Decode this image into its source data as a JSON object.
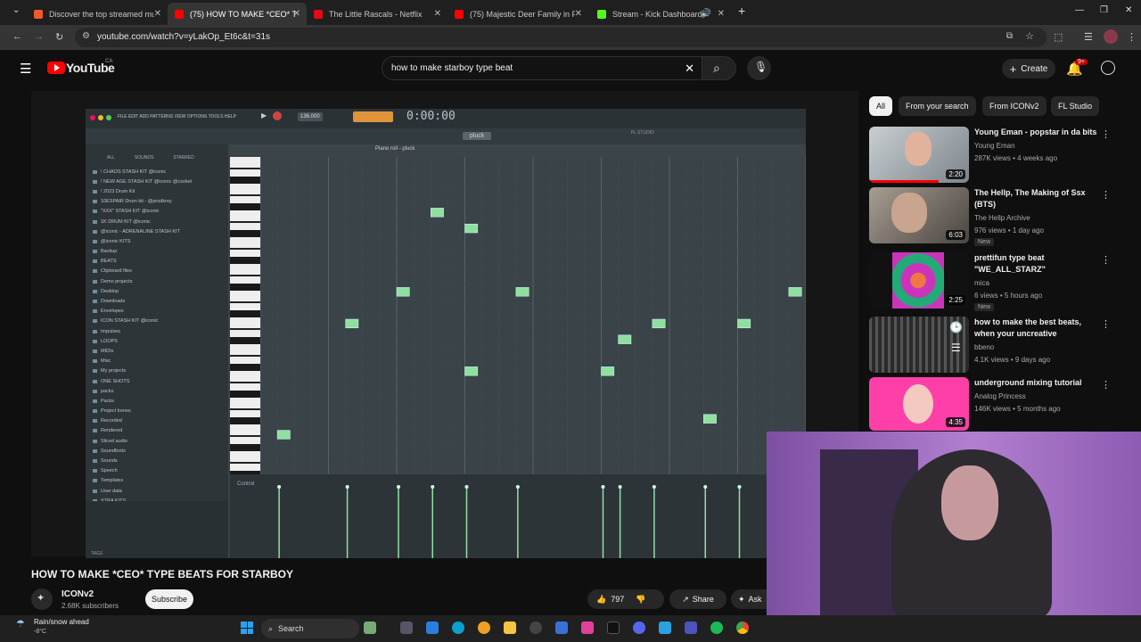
{
  "browser": {
    "tabs": [
      {
        "title": "Discover the top streamed mu",
        "color": "#f05a28"
      },
      {
        "title": "(75) HOW TO MAKE *CEO* TYP",
        "color": "#ff0000"
      },
      {
        "title": "The Little Rascals - Netflix",
        "color": "#e50914"
      },
      {
        "title": "(75) Majestic Deer Family in Fo",
        "color": "#ff0000"
      },
      {
        "title": "Stream - Kick Dashboard",
        "color": "#53fc18"
      }
    ],
    "url": "youtube.com/watch?v=yLakOp_Et6c&t=31s"
  },
  "youtube": {
    "logo": "YouTube",
    "region": "CA",
    "search_query": "how to make starboy type beat",
    "create_label": "Create",
    "notif_count": "9+"
  },
  "chips": [
    "All",
    "From your search",
    "From ICONv2",
    "FL Studio"
  ],
  "video": {
    "title": "HOW TO MAKE *CEO* TYPE BEATS FOR STARBOY",
    "channel": "ICONv2",
    "subscribers": "2.68K subscribers",
    "subscribe_label": "Subscribe",
    "likes": "797",
    "share_label": "Share",
    "ask_label": "Ask"
  },
  "fl": {
    "menu": "FILE  EDIT  ADD  PATTERNS  VIEW  OPTIONS  TOOLS  HELP",
    "tempo": "136.000",
    "time": "0:00:00",
    "browser_tabs": [
      "ALL",
      "SOUNDS",
      "STARRED"
    ],
    "folders": [
      "! CHAOS STASH KIT @iconic",
      "! NEW AGE STASH KIT @iconic @csxket",
      "! 2023 Drum Kit",
      "10ESPAIR Drum kit - @prodkrey",
      "\"XXX\" STASH KIT @iconic",
      "1K DRUM KIT @iconic",
      "@iconic - ADRENALINE STASH KIT",
      "@iconic KITS",
      "Backup",
      "BEATS",
      "Clipboard files",
      "Demo projects",
      "Desktop",
      "Downloads",
      "Envelopes",
      "ICON STASH KIT @iconic",
      "Impulses",
      "LOOPS",
      "MIDIs",
      "Misc",
      "My projects",
      "ONE SHOTS",
      "packs",
      "Packs",
      "Project bones",
      "Recorded",
      "Rendered",
      "Sliced audio",
      "Soundfonts",
      "Sounds",
      "Speech",
      "Templates",
      "User data",
      "XTRA KITS"
    ],
    "piano_roll_title": "Piano roll - pluck",
    "instrument": "pluck",
    "control_label": "Control",
    "tags_label": "TAGS",
    "studio_label": "FL STUDIO",
    "notes": [
      {
        "step": 1,
        "row": 17
      },
      {
        "step": 5,
        "row": 10
      },
      {
        "step": 8,
        "row": 8
      },
      {
        "step": 10,
        "row": 3
      },
      {
        "step": 12,
        "row": 4
      },
      {
        "step": 12,
        "row": 13
      },
      {
        "step": 15,
        "row": 8
      },
      {
        "step": 20,
        "row": 13
      },
      {
        "step": 21,
        "row": 11
      },
      {
        "step": 23,
        "row": 10
      },
      {
        "step": 26,
        "row": 16
      },
      {
        "step": 28,
        "row": 10
      },
      {
        "step": 31,
        "row": 8
      }
    ],
    "velocity_steps": [
      1,
      5,
      8,
      10,
      12,
      15,
      20,
      21,
      23,
      26,
      28
    ]
  },
  "recommendations": [
    {
      "title": "Young Eman - popstar in da bits",
      "channel": "Young Eman",
      "meta": "287K views • 4 weeks ago",
      "duration": "2:20",
      "badge": "",
      "thumb_color": "#9aa2a8"
    },
    {
      "title": "The Hellp, The Making of Ssx (BTS)",
      "channel": "The Hellp Archive",
      "meta": "976 views • 1 day ago",
      "duration": "6:03",
      "badge": "New",
      "thumb_color": "#6b6560"
    },
    {
      "title": "prettifun type beat \"WE_ALL_STARZ\"",
      "channel": "mica",
      "meta": "6 views • 5 hours ago",
      "duration": "2:25",
      "badge": "New",
      "thumb_color": "#c63bb0"
    },
    {
      "title": "how to make the best beats, when your uncreative",
      "channel": "bbeno",
      "meta": "4.1K views • 9 days ago",
      "duration": "",
      "badge": "",
      "thumb_color": "#3a3a3a"
    },
    {
      "title": "underground mixing tutorial",
      "channel": "Analog Princess",
      "meta": "146K views • 5 months ago",
      "duration": "4:35",
      "badge": "",
      "thumb_color": "#ff3fa8"
    }
  ],
  "weather": {
    "line1": "Rain/snow ahead",
    "line2": "-8°C"
  },
  "taskbar": {
    "search_label": "Search"
  }
}
